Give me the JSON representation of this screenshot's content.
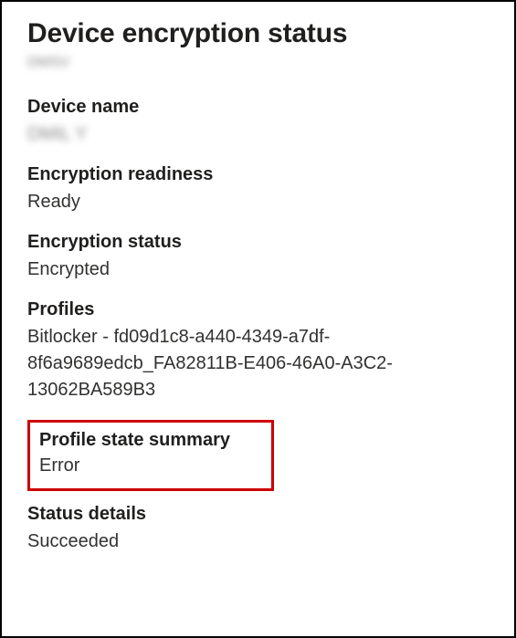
{
  "title": "Device encryption status",
  "subtitle_redacted": "DMSV",
  "device_name": {
    "label": "Device name",
    "value_redacted": "DMIL Y"
  },
  "encryption_readiness": {
    "label": "Encryption readiness",
    "value": "Ready"
  },
  "encryption_status": {
    "label": "Encryption status",
    "value": "Encrypted"
  },
  "profiles": {
    "label": "Profiles",
    "value": "Bitlocker - fd09d1c8-a440-4349-a7df-8f6a9689edcb_FA82811B-E406-46A0-A3C2-13062BA589B3"
  },
  "profile_state_summary": {
    "label": "Profile state summary",
    "value": "Error"
  },
  "status_details": {
    "label": "Status details",
    "value": "Succeeded"
  }
}
